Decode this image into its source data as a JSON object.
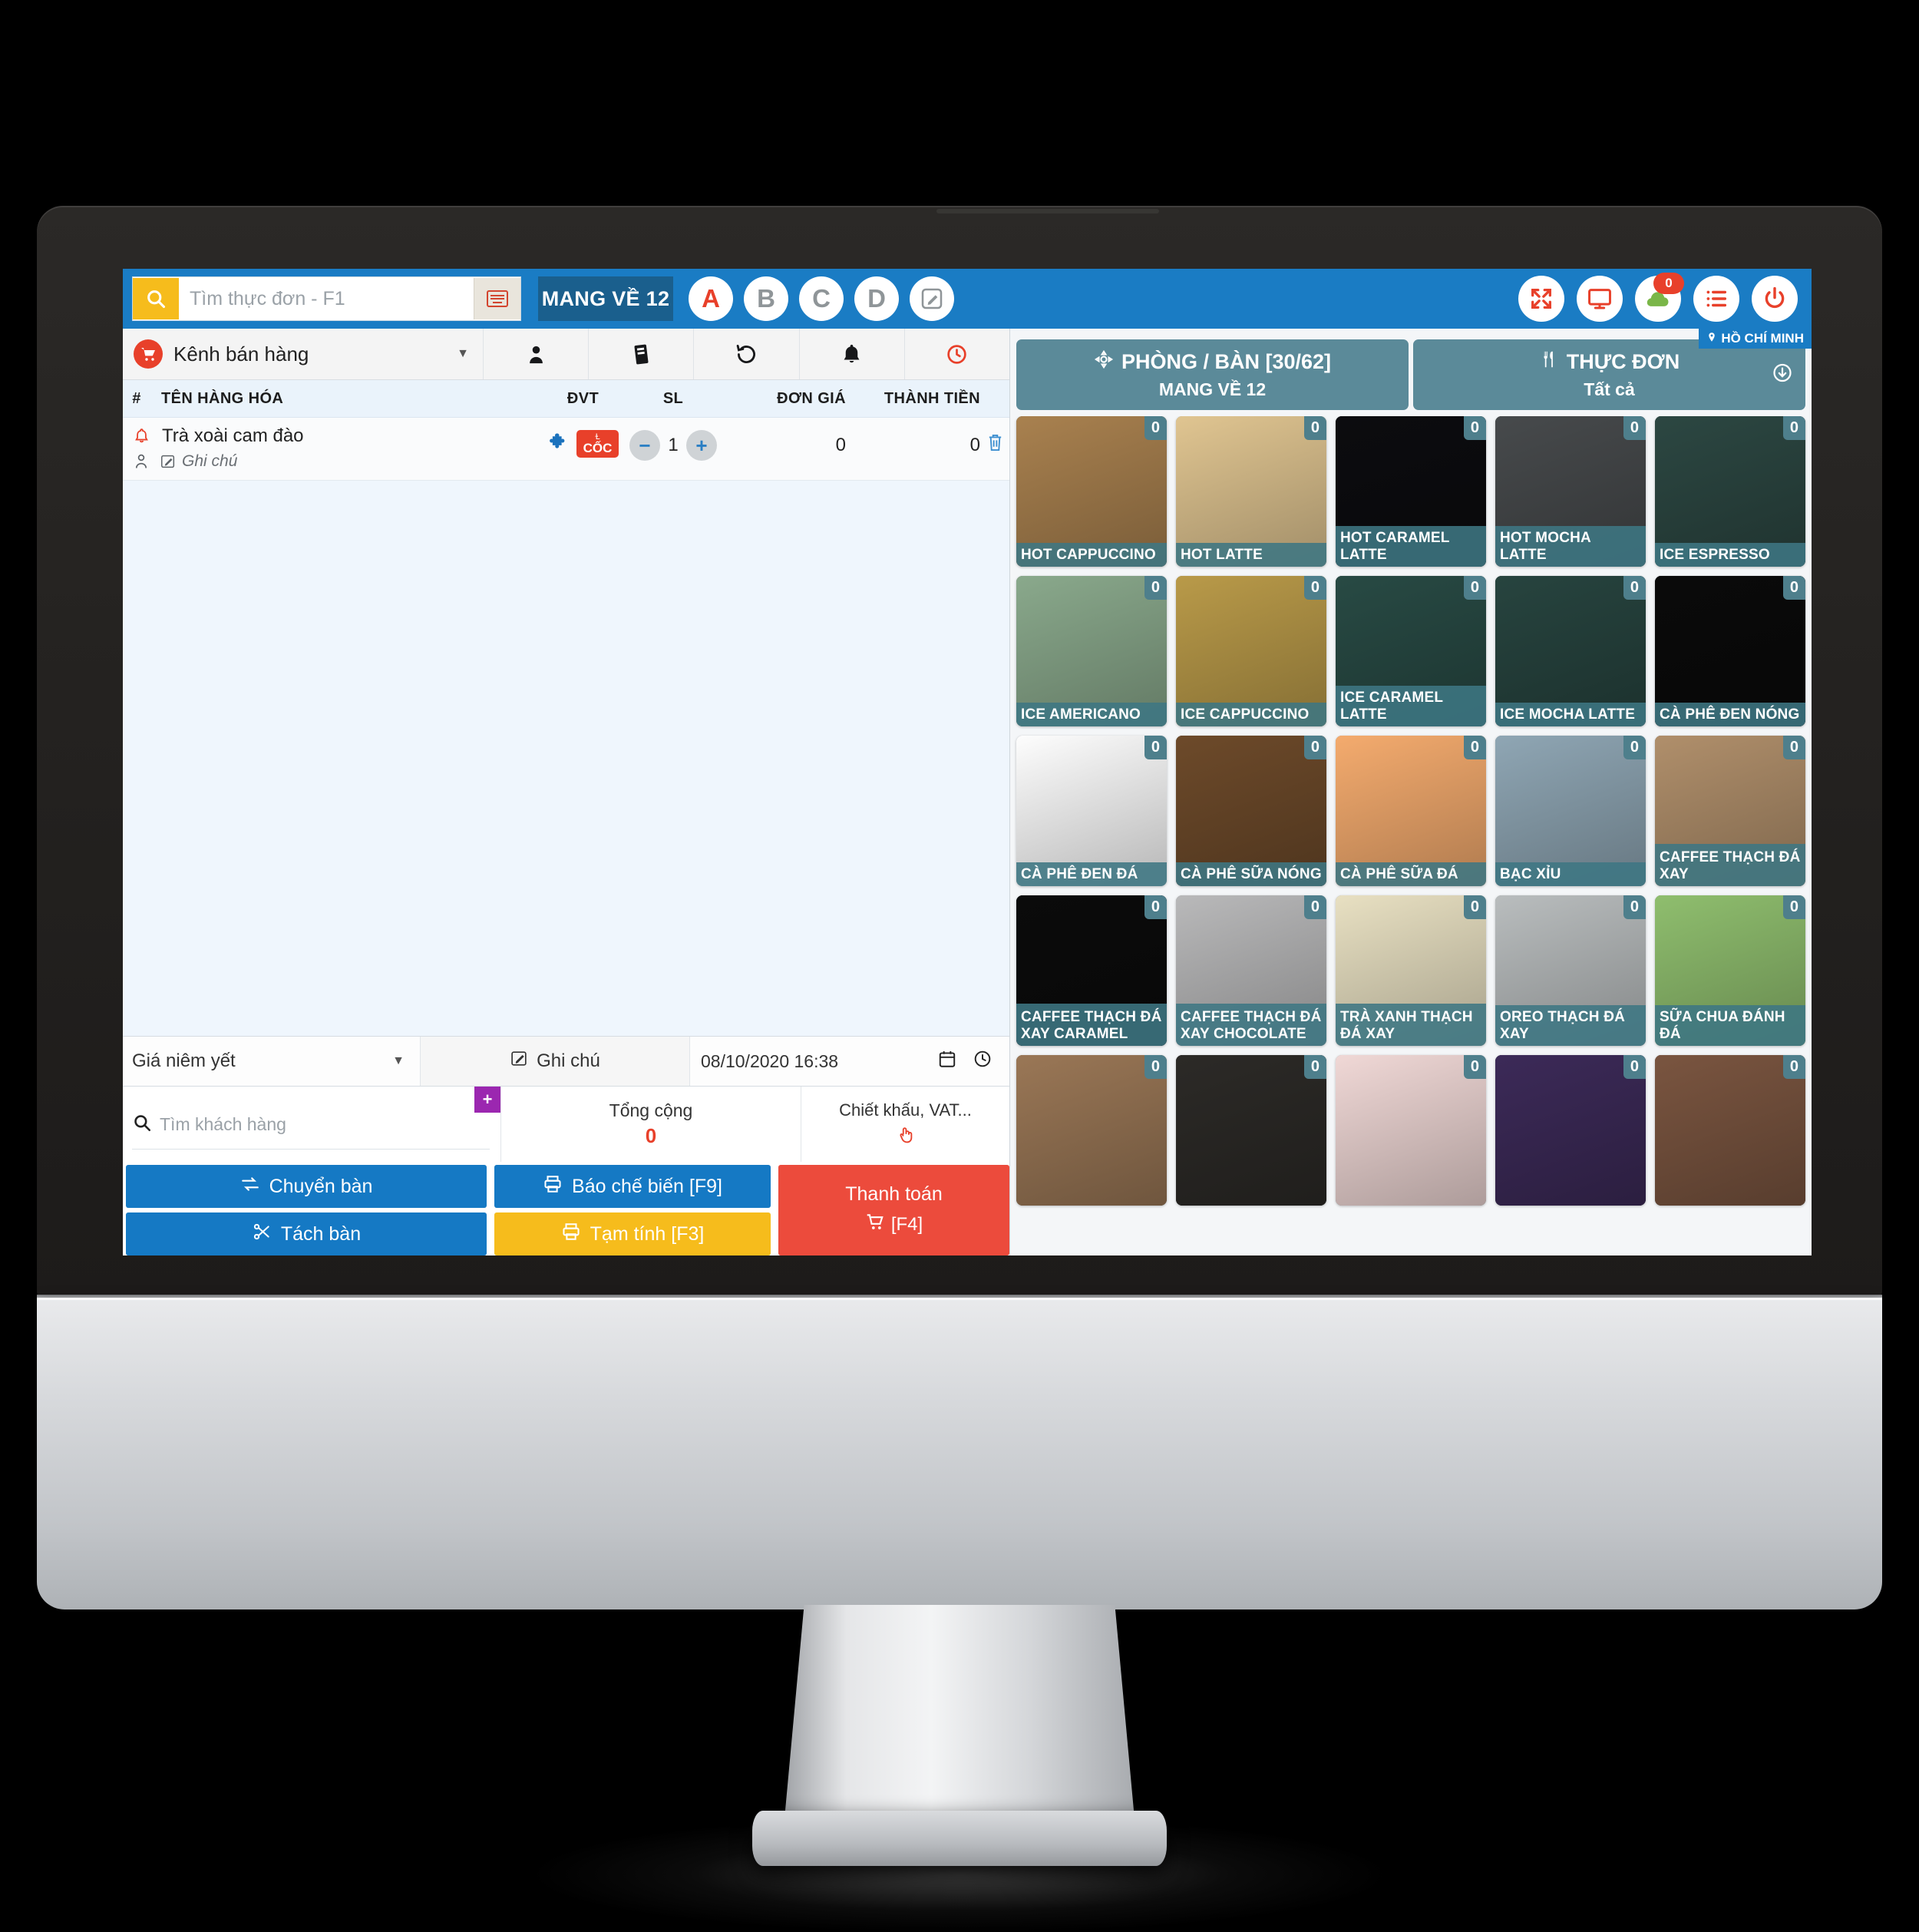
{
  "topbar": {
    "search_placeholder": "Tìm thực đơn - F1",
    "search_value": "",
    "order_tag": "MANG VỀ 12",
    "circles": [
      {
        "label": "A",
        "active": true
      },
      {
        "label": "B",
        "active": false
      },
      {
        "label": "C",
        "active": false
      },
      {
        "label": "D",
        "active": false
      }
    ],
    "edit_icon": "edit-square-icon",
    "keyboard_icon": "keyboard-icon",
    "right_icons": [
      {
        "name": "fullscreen-icon",
        "badge": null
      },
      {
        "name": "monitor-icon",
        "badge": null
      },
      {
        "name": "cloud-icon",
        "badge": "0"
      },
      {
        "name": "list-icon",
        "badge": null
      },
      {
        "name": "power-icon",
        "badge": null
      }
    ]
  },
  "left_toolbar": {
    "channel_label": "Kênh bán hàng",
    "icons": [
      "customer-icon",
      "receipt-icon",
      "history-icon",
      "bell-icon",
      "clock-icon"
    ]
  },
  "table": {
    "headers": {
      "num": "#",
      "name": "TÊN HÀNG HÓA",
      "unit": "ĐVT",
      "qty": "SL",
      "price": "ĐƠN GIÁ",
      "total": "THÀNH TIỀN"
    },
    "rows": [
      {
        "name": "Trà xoài cam đào",
        "note_placeholder": "Ghi chú",
        "unit_badge": "CỐC",
        "qty": "1",
        "price": "0",
        "total": "0"
      }
    ]
  },
  "footer": {
    "price_policy": "Giá niêm yết",
    "note_label": "Ghi chú",
    "datetime": "08/10/2020 16:38",
    "customer_placeholder": "Tìm khách hàng",
    "add_customer": "+",
    "total_label": "Tổng cộng",
    "total_value": "0",
    "discount_label": "Chiết khấu, VAT...",
    "buttons": {
      "transfer_table": "Chuyển bàn",
      "split_table": "Tách bàn",
      "report_kitchen": "Báo chế biến [F9]",
      "provisional": "Tạm tính [F3]",
      "pay": "Thanh toán",
      "pay_key": "[F4]"
    }
  },
  "right_panel": {
    "location_badge": "HỒ CHÍ MINH",
    "tabs": [
      {
        "title": "PHÒNG / BÀN [30/62]",
        "subtitle": "MANG VỀ 12",
        "icon": "table-grid-icon"
      },
      {
        "title": "THỰC ĐƠN",
        "subtitle": "Tất cả",
        "icon": "cutlery-icon"
      }
    ],
    "products": [
      {
        "name": "HOT CAPPUCCINO",
        "count": "0",
        "bg": "#a9814f"
      },
      {
        "name": "HOT LATTE",
        "count": "0",
        "bg": "#e0c591"
      },
      {
        "name": "HOT CARAMEL LATTE",
        "count": "0",
        "bg": "#0c0c0f"
      },
      {
        "name": "HOT MOCHA LATTE",
        "count": "0",
        "bg": "#474a4c"
      },
      {
        "name": "ICE ESPRESSO",
        "count": "0",
        "bg": "#2c4742"
      },
      {
        "name": "ICE AMERICANO",
        "count": "0",
        "bg": "#8aa98c"
      },
      {
        "name": "ICE CAPPUCCINO",
        "count": "0",
        "bg": "#b99a49"
      },
      {
        "name": "ICE CARAMEL LATTE",
        "count": "0",
        "bg": "#284a44"
      },
      {
        "name": "ICE MOCHA LATTE",
        "count": "0",
        "bg": "#27443f"
      },
      {
        "name": "CÀ PHÊ ĐEN NÓNG",
        "count": "0",
        "bg": "#0a0a0a"
      },
      {
        "name": "CÀ PHÊ ĐEN ĐÁ",
        "count": "0",
        "bg": "#fdfdfd"
      },
      {
        "name": "CÀ PHÊ SỮA NÓNG",
        "count": "0",
        "bg": "#6d4a2a"
      },
      {
        "name": "CÀ PHÊ SỮA ĐÁ",
        "count": "0",
        "bg": "#f4ab6e"
      },
      {
        "name": "BẠC XỈU",
        "count": "0",
        "bg": "#8fa6b4"
      },
      {
        "name": "CAFFEE THẠCH ĐÁ XAY",
        "count": "0",
        "bg": "#b08f6b"
      },
      {
        "name": "CAFFEE THẠCH ĐÁ XAY CARAMEL",
        "count": "0",
        "bg": "#0b0b0b"
      },
      {
        "name": "CAFFEE THẠCH ĐÁ XAY CHOCOLATE",
        "count": "0",
        "bg": "#b9b9ba"
      },
      {
        "name": "TRÀ XANH THẠCH ĐÁ XAY",
        "count": "0",
        "bg": "#e8e0c2"
      },
      {
        "name": "OREO THẠCH ĐÁ XAY",
        "count": "0",
        "bg": "#b9bdbe"
      },
      {
        "name": "SỮA CHUA ĐÁNH ĐÁ",
        "count": "0",
        "bg": "#8fbe6e"
      },
      {
        "name": "",
        "count": "0",
        "bg": "#9a7756"
      },
      {
        "name": "",
        "count": "0",
        "bg": "#2c2a27"
      },
      {
        "name": "",
        "count": "0",
        "bg": "#f0d8d6"
      },
      {
        "name": "",
        "count": "0",
        "bg": "#3c2a58"
      },
      {
        "name": "",
        "count": "0",
        "bg": "#7a5540"
      }
    ]
  },
  "colors": {
    "brand_blue": "#1a7cc4",
    "dark_blue": "#1a5f8d",
    "accent_yellow": "#f6bc1c",
    "accent_red": "#e8402a",
    "teal": "#5b8a99",
    "pay_red": "#ec4b3c"
  }
}
